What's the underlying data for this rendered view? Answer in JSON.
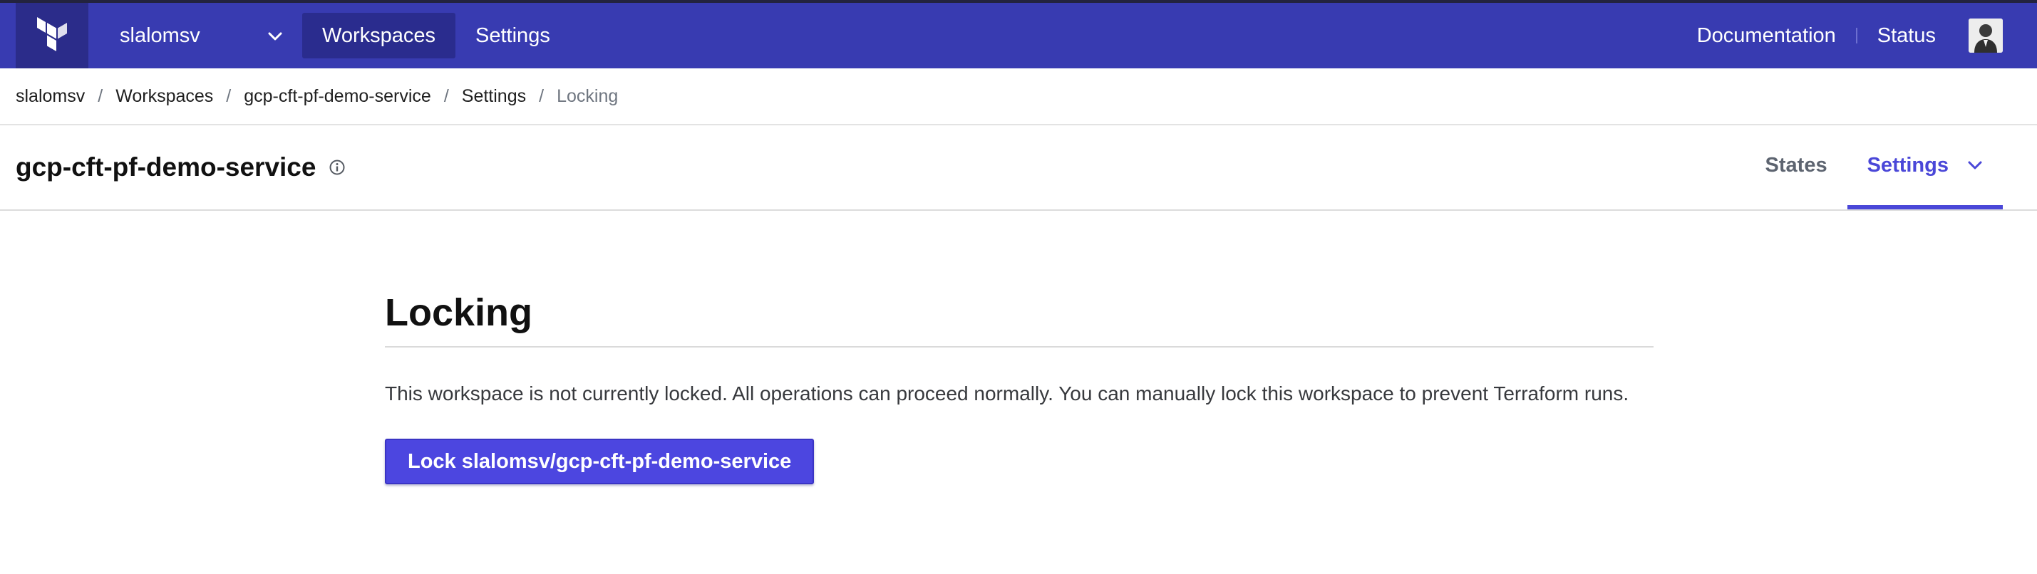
{
  "topnav": {
    "org_name": "slalomsv",
    "links": [
      "Workspaces",
      "Settings"
    ],
    "right_links": [
      "Documentation",
      "Status"
    ]
  },
  "breadcrumb": {
    "items": [
      "slalomsv",
      "Workspaces",
      "gcp-cft-pf-demo-service",
      "Settings",
      "Locking"
    ],
    "separator": "/"
  },
  "workspace": {
    "name": "gcp-cft-pf-demo-service",
    "tabs": [
      "States",
      "Settings"
    ]
  },
  "page": {
    "heading": "Locking",
    "description": "This workspace is not currently locked. All operations can proceed normally. You can manually lock this workspace to prevent Terraform runs.",
    "lock_button_label": "Lock slalomsv/gcp-cft-pf-demo-service"
  },
  "colors": {
    "topbar": "#383bb1",
    "accent": "#4a47d8",
    "button": "#4c46e0"
  },
  "icons": [
    "terraform-logo-icon",
    "chevron-down-icon",
    "info-icon",
    "user-avatar"
  ]
}
